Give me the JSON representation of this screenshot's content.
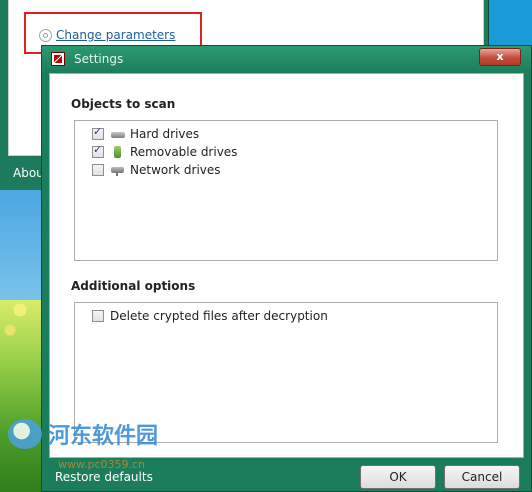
{
  "main_window": {
    "change_parameters_link": "Change parameters",
    "about_label": "Abou"
  },
  "settings_dialog": {
    "title": "Settings",
    "close_label": "x",
    "objects_section_title": "Objects to scan",
    "objects": [
      {
        "label": "Hard drives",
        "checked": true,
        "icon": "hard-drive-icon"
      },
      {
        "label": "Removable drives",
        "checked": true,
        "icon": "removable-drive-icon"
      },
      {
        "label": "Network drives",
        "checked": false,
        "icon": "network-drive-icon"
      }
    ],
    "additional_section_title": "Additional options",
    "additional_options": [
      {
        "label": "Delete crypted files after decryption",
        "checked": false
      }
    ],
    "restore_defaults_label": "Restore defaults",
    "ok_label": "OK",
    "cancel_label": "Cancel"
  },
  "watermark": {
    "text": "河东软件园",
    "url": "www.pc0359.cn"
  },
  "colors": {
    "dialog_frame": "#1b7d5c",
    "highlight": "#e02020",
    "link": "#1f5fa0"
  }
}
